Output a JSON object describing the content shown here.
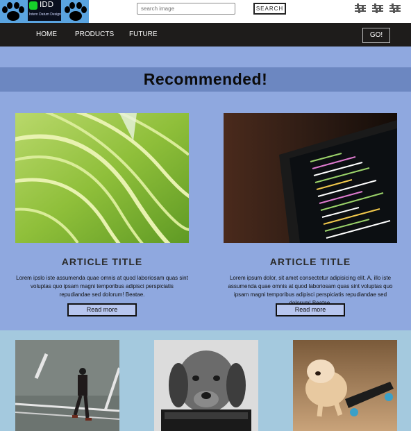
{
  "header": {
    "logo": {
      "brand": "IDD",
      "tagline": "Intern Datum Design"
    },
    "search": {
      "placeholder": "search image",
      "button_label": "SEARCH"
    },
    "settings_icons": [
      "sliders-icon",
      "sliders-icon",
      "sliders-icon"
    ]
  },
  "nav": {
    "items": [
      "HOME",
      "PRODUCTS",
      "FUTURE"
    ],
    "go_label": "GO!"
  },
  "recommended": {
    "title": "Recommended!"
  },
  "articles": [
    {
      "title": "ARTICLE TITLE",
      "text": "Lorem ipslo iste assumenda quae omnis at quod laboriosam quas sint voluptas quo ipsam magni temporibus adipisci perspiciatis repudiandae sed dolorum! Beatae.",
      "button_label": "Read more",
      "image": "green-leaf-photo"
    },
    {
      "title": "ARTICLE TITLE",
      "text": "Lorem ipsum dolor, sit amet consectetur adipisicing elit. A, illo iste assumenda quae omnis at quod laboriosam quas sint voluptas quo ipsam magni temporibus adipisci perspiciatis repudiandae sed dolorum! Beatae.",
      "button_label": "Read more",
      "image": "laptop-code-photo"
    }
  ],
  "gallery": [
    "man-walking-photo",
    "dog-on-laptop-photo",
    "bulldog-skateboard-photo"
  ],
  "colors": {
    "page_bg": "#8fa8df",
    "band": "#6c87c1",
    "nav": "#1e1c1b",
    "gallery_bg": "#a4c9de",
    "button_bg": "#b7c6ef"
  }
}
